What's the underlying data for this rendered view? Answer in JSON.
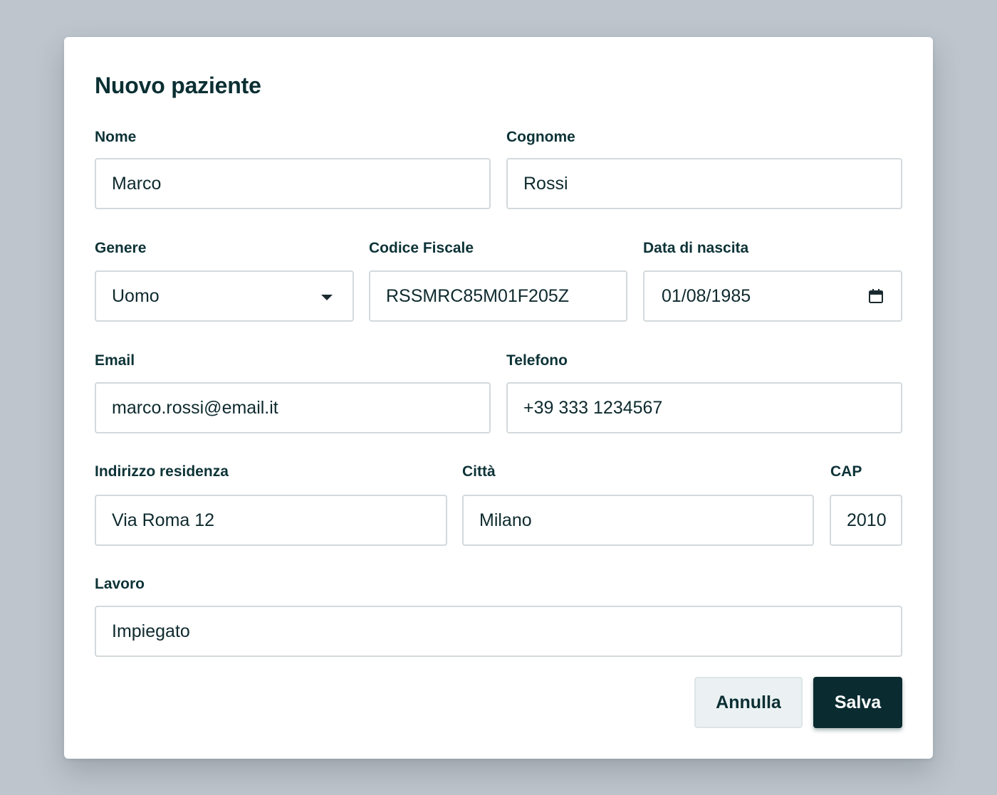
{
  "dialog": {
    "title": "Nuovo paziente"
  },
  "fields": {
    "nome": {
      "label": "Nome",
      "value": "Marco"
    },
    "cognome": {
      "label": "Cognome",
      "value": "Rossi"
    },
    "genere": {
      "label": "Genere",
      "value": "Uomo"
    },
    "codice_fiscale": {
      "label": "Codice Fiscale",
      "value": "RSSMRC85M01F205Z"
    },
    "data_nascita": {
      "label": "Data di nascita",
      "value": "01/08/1985"
    },
    "email": {
      "label": "Email",
      "value": "marco.rossi@email.it"
    },
    "telefono": {
      "label": "Telefono",
      "value": "+39 333 1234567"
    },
    "indirizzo": {
      "label": "Indirizzo residenza",
      "value": "Via Roma 12"
    },
    "citta": {
      "label": "Città",
      "value": "Milano"
    },
    "cap": {
      "label": "CAP",
      "value": "2010"
    },
    "lavoro": {
      "label": "Lavoro",
      "value": "Impiegato"
    }
  },
  "actions": {
    "cancel_label": "Annulla",
    "save_label": "Salva"
  },
  "icons": {
    "genere_dropdown": "chevron-down-icon",
    "data_nascita_picker": "calendar-icon"
  },
  "colors": {
    "backdrop": "#bec5cc",
    "dialog_background": "#ffffff",
    "primary_button": "#0a2b30",
    "secondary_button": "#ebf1f2",
    "text": "#0b2f33",
    "field_border": "#d3d9dc"
  }
}
